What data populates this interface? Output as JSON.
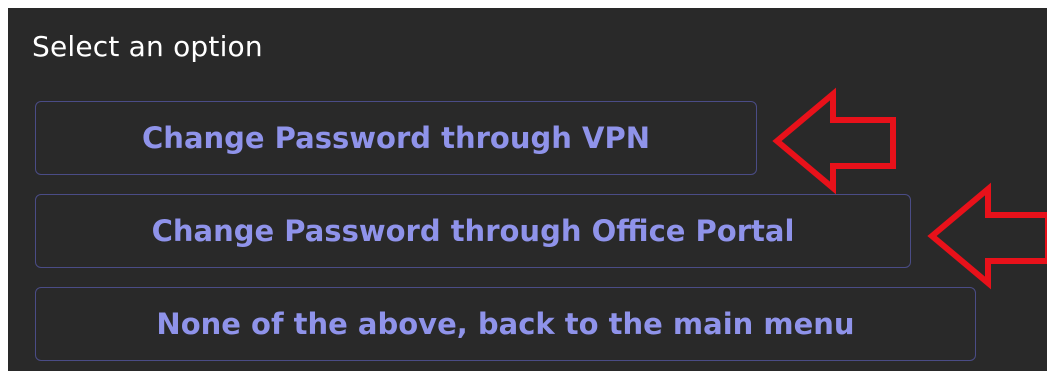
{
  "prompt": {
    "text": "Select an option"
  },
  "options": [
    {
      "label": "Change Password through VPN"
    },
    {
      "label": "Change Password through Office Portal"
    },
    {
      "label": "None of the above, back to the main menu"
    }
  ],
  "annotations": {
    "arrow_icon": "left-arrow-outline-icon",
    "arrow_color": "#e8111a"
  },
  "colors": {
    "panel_background": "#292929",
    "option_text": "#8f93ea",
    "option_border": "#4a4c86",
    "prompt_text": "#ffffff"
  }
}
